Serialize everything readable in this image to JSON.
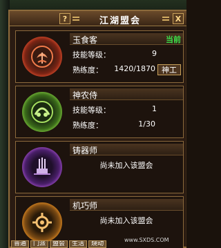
{
  "window": {
    "title": "江湖盟会",
    "help_label": "?",
    "close_label": "X"
  },
  "guilds": [
    {
      "name": "玉食客",
      "status": "当前",
      "skill_level_label": "技能等级：",
      "skill_level": "9",
      "proficiency_label": "熟练度：",
      "proficiency": "1420/1870",
      "action_label": "神工",
      "emblem": "phoenix-emblem-icon",
      "color": "#d84a2a"
    },
    {
      "name": "神农侍",
      "skill_level_label": "技能等级：",
      "skill_level": "1",
      "proficiency_label": "熟练度：",
      "proficiency": "1/30",
      "emblem": "herb-emblem-icon",
      "color": "#7ac03a"
    },
    {
      "name": "铸器师",
      "message": "尚未加入该盟会",
      "emblem": "forge-emblem-icon",
      "color": "#9a4ac0"
    },
    {
      "name": "机巧师",
      "message": "尚未加入该盟会",
      "emblem": "gear-emblem-icon",
      "color": "#e08a20"
    }
  ],
  "tabs": [
    "普通",
    "门派",
    "盟会",
    "生活",
    "烧动"
  ],
  "watermark": "www.SXDS.COM"
}
